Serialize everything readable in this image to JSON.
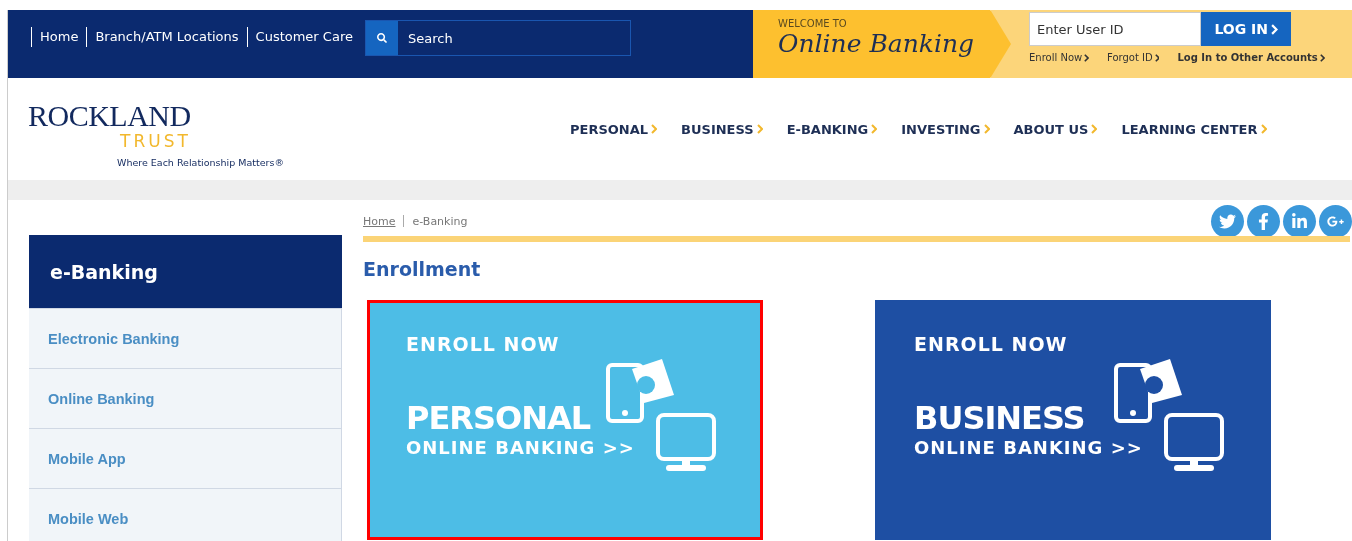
{
  "top_links": [
    "Home",
    "Branch/ATM Locations",
    "Customer Care"
  ],
  "search": {
    "placeholder": "Search"
  },
  "welcome": {
    "kicker": "WELCOME TO",
    "title": "Online Banking"
  },
  "login": {
    "placeholder": "Enter User ID",
    "button": "LOG IN",
    "links": [
      {
        "label": "Enroll Now",
        "bold": false
      },
      {
        "label": "Forgot ID",
        "bold": false
      },
      {
        "label": "Log In to Other Accounts",
        "bold": true
      }
    ]
  },
  "logo": {
    "name": "ROCKLAND",
    "sub": "TRUST",
    "tagline": "Where Each Relationship Matters®"
  },
  "main_nav": [
    "PERSONAL",
    "BUSINESS",
    "E-BANKING",
    "INVESTING",
    "ABOUT US",
    "LEARNING CENTER"
  ],
  "sidebar": {
    "title": "e-Banking",
    "items": [
      "Electronic Banking",
      "Online Banking",
      "Mobile App",
      "Mobile Web"
    ]
  },
  "breadcrumb": [
    {
      "label": "Home",
      "link": true
    },
    {
      "label": "e-Banking",
      "link": false
    }
  ],
  "social": [
    {
      "kind": "twitter"
    },
    {
      "kind": "facebook"
    },
    {
      "kind": "linkedin"
    },
    {
      "kind": "googleplus"
    }
  ],
  "heading": "Enrollment",
  "tiles": [
    {
      "kicker": "ENROLL NOW",
      "title": "PERSONAL",
      "subtitle": "ONLINE BANKING >>",
      "color": "#4dbde6",
      "highlighted": true
    },
    {
      "kicker": "ENROLL NOW",
      "title": "BUSINESS",
      "subtitle": "ONLINE BANKING >>",
      "color": "#1e4fa3",
      "highlighted": false
    }
  ]
}
